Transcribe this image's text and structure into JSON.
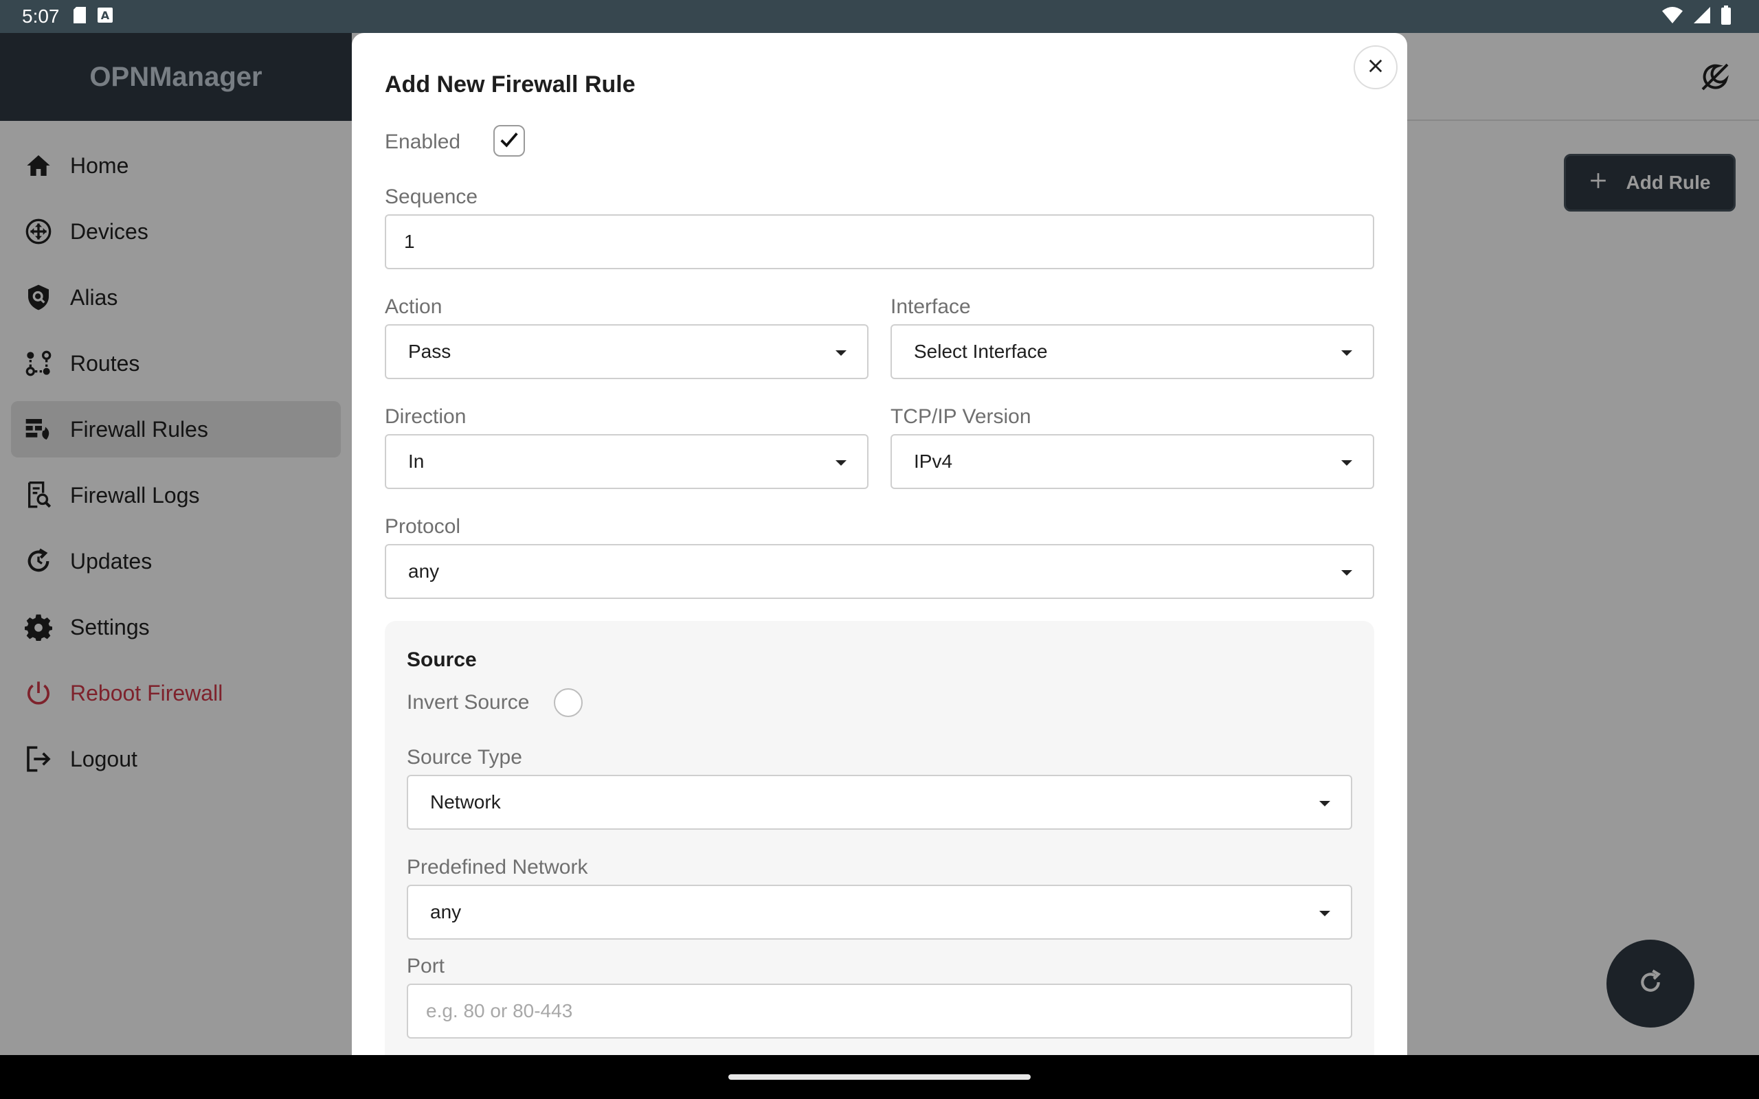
{
  "status_bar": {
    "time": "5:07"
  },
  "sidebar": {
    "brand": "OPNManager",
    "items": [
      {
        "label": "Home",
        "icon": "home-icon"
      },
      {
        "label": "Devices",
        "icon": "devices-icon"
      },
      {
        "label": "Alias",
        "icon": "shield-search-icon"
      },
      {
        "label": "Routes",
        "icon": "routes-icon"
      },
      {
        "label": "Firewall Rules",
        "icon": "firewall-icon",
        "active": true
      },
      {
        "label": "Firewall Logs",
        "icon": "logs-search-icon"
      },
      {
        "label": "Updates",
        "icon": "updates-icon"
      },
      {
        "label": "Settings",
        "icon": "gear-icon"
      },
      {
        "label": "Reboot Firewall",
        "icon": "power-icon",
        "color": "#d23a4a"
      },
      {
        "label": "Logout",
        "icon": "logout-icon"
      }
    ]
  },
  "main": {
    "add_rule_label": "Add Rule"
  },
  "dialog": {
    "title": "Add New Firewall Rule",
    "enabled": {
      "label": "Enabled",
      "checked": true
    },
    "sequence": {
      "label": "Sequence",
      "value": "1"
    },
    "action": {
      "label": "Action",
      "value": "Pass"
    },
    "interface": {
      "label": "Interface",
      "value": "Select Interface"
    },
    "direction": {
      "label": "Direction",
      "value": "In"
    },
    "ip_version": {
      "label": "TCP/IP Version",
      "value": "IPv4"
    },
    "protocol": {
      "label": "Protocol",
      "value": "any"
    },
    "source": {
      "title": "Source",
      "invert": {
        "label": "Invert Source",
        "checked": false
      },
      "type": {
        "label": "Source Type",
        "value": "Network"
      },
      "network": {
        "label": "Predefined Network",
        "value": "any"
      },
      "port": {
        "label": "Port",
        "placeholder": "e.g. 80 or 80-443"
      }
    }
  },
  "colors": {
    "sidebar_header": "#2f3a44",
    "danger": "#d23a4a",
    "scrim": "rgba(0,0,0,0.40)"
  }
}
